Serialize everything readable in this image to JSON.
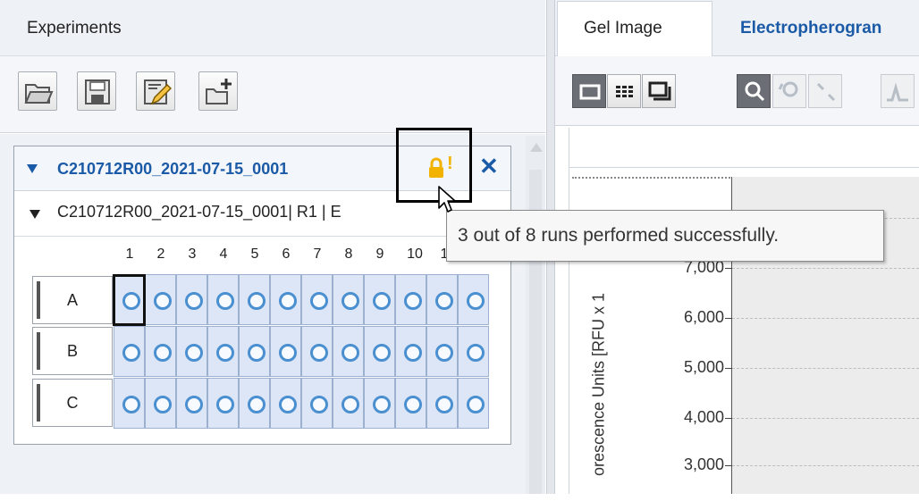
{
  "experiments_panel": {
    "title": "Experiments",
    "toolbar": {
      "buttons": [
        {
          "name": "open-folder-icon"
        },
        {
          "name": "save-icon"
        },
        {
          "name": "edit-icon"
        },
        {
          "name": "new-experiment-icon"
        }
      ]
    },
    "experiment": {
      "name": "C210712R00_2021-07-15_0001",
      "status_icons": [
        "lock-icon",
        "warning-icon"
      ],
      "warning_mark": "!",
      "close_label": "✕",
      "run_label": "C210712R00_2021-07-15_0001| R1 | E"
    },
    "plate": {
      "columns": [
        "1",
        "2",
        "3",
        "4",
        "5",
        "6",
        "7",
        "8",
        "9",
        "10",
        "1"
      ],
      "rows": [
        "A",
        "B",
        "C"
      ],
      "wells_per_row": 12
    }
  },
  "tooltip": "3 out of 8 runs performed successfully.",
  "right_panel": {
    "tabs": [
      {
        "label": "Gel Image",
        "active": true
      },
      {
        "label": "Electropherogran",
        "active": false
      }
    ],
    "toolbar_icons": [
      "single-view-icon",
      "grid-view-icon",
      "overlay-view-icon",
      "zoom-icon",
      "lasso-zoom-icon",
      "fit-icon",
      "peak-icon"
    ],
    "chart": {
      "ylabel": "orescence Units [RFU x 1",
      "yticks": [
        "7,000",
        "6,000",
        "5,000",
        "4,000",
        "3,000"
      ]
    }
  },
  "colors": {
    "accent": "#1b5aa6",
    "warning": "#f2b300",
    "well_fill": "#dde6f6"
  }
}
